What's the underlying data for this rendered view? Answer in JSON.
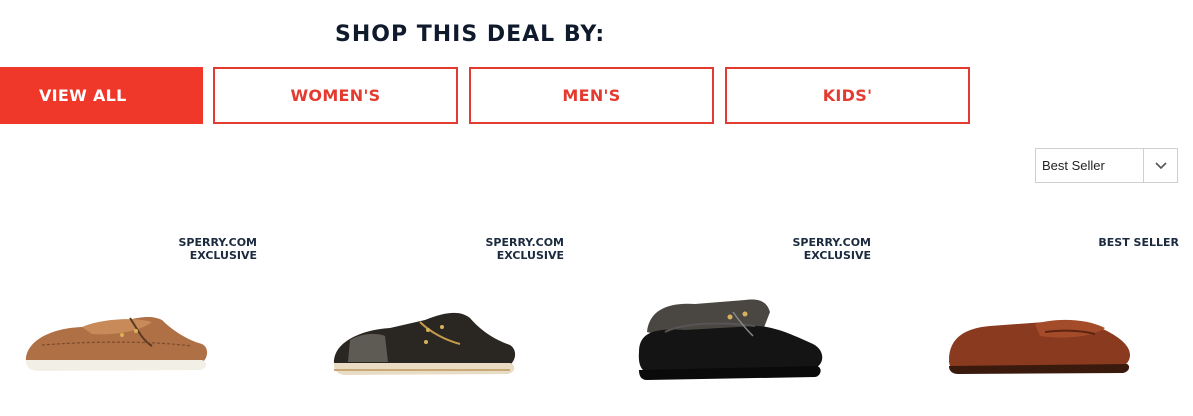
{
  "heading": "SHOP THIS DEAL BY:",
  "filters": [
    {
      "label": "VIEW ALL",
      "active": true
    },
    {
      "label": "WOMEN'S",
      "active": false
    },
    {
      "label": "MEN'S",
      "active": false
    },
    {
      "label": "KIDS'",
      "active": false
    }
  ],
  "sort": {
    "selected": "Best Seller",
    "icon": "chevron-down-icon"
  },
  "products": [
    {
      "badge_line1": "SPERRY.COM",
      "badge_line2": "EXCLUSIVE",
      "image": "boat-shoe-tan"
    },
    {
      "badge_line1": "SPERRY.COM",
      "badge_line2": "EXCLUSIVE",
      "image": "boat-shoe-black-leopard"
    },
    {
      "badge_line1": "SPERRY.COM",
      "badge_line2": "EXCLUSIVE",
      "image": "duck-boot-black-leopard"
    },
    {
      "badge_line1": "BEST SELLER",
      "badge_line2": "",
      "image": "penny-loafer-brown"
    }
  ],
  "colors": {
    "accent": "#ef3829",
    "heading": "#0f1b2d"
  }
}
